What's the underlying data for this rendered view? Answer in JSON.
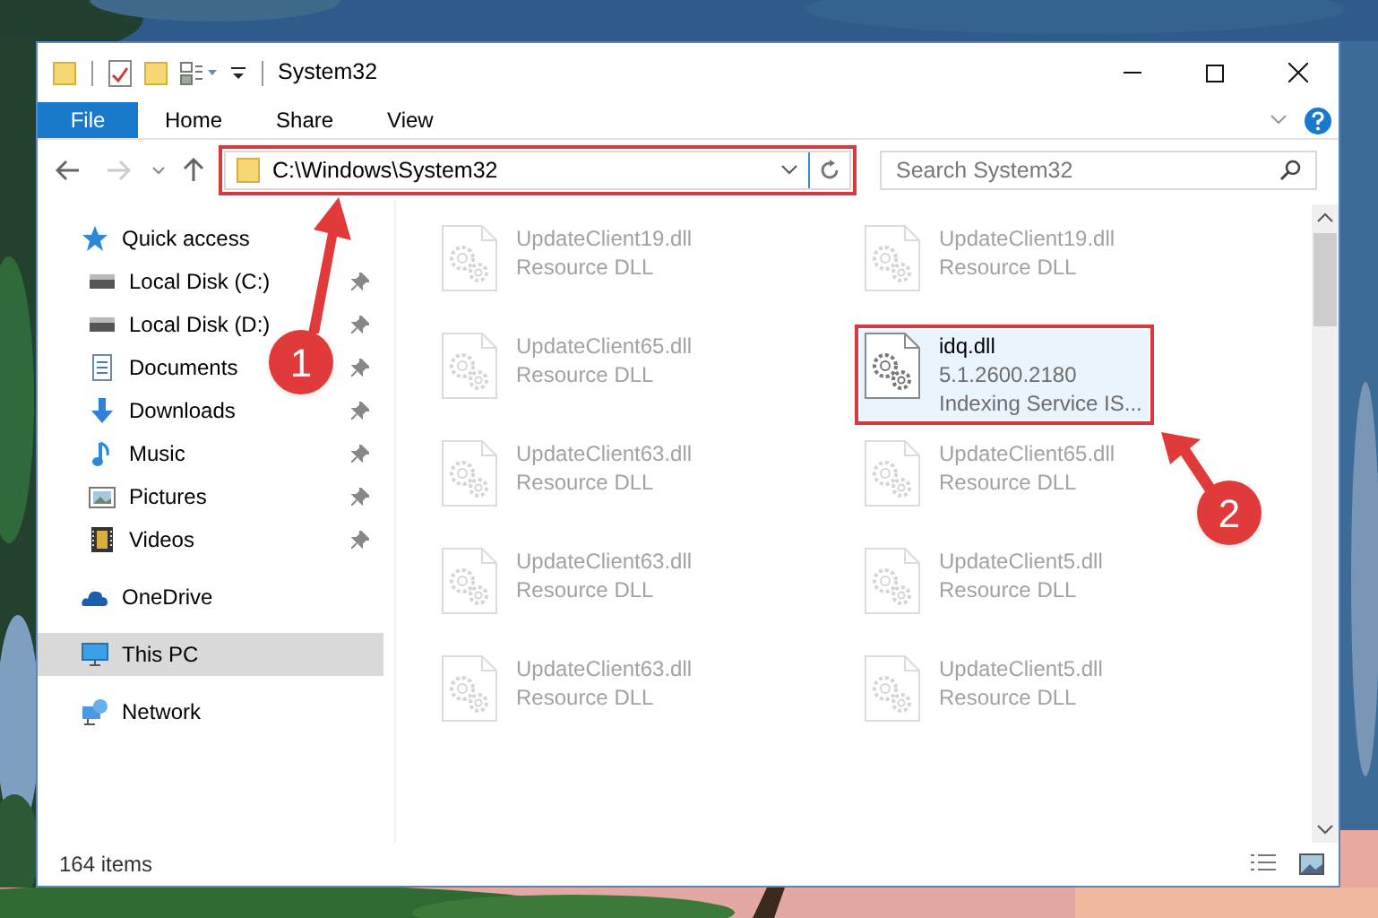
{
  "window": {
    "title": "System32"
  },
  "ribbon": {
    "tabs": [
      {
        "label": "File",
        "kind": "file",
        "selected": false
      },
      {
        "label": "Home",
        "kind": "tab",
        "selected": false
      },
      {
        "label": "Share",
        "kind": "tab",
        "selected": false
      },
      {
        "label": "View",
        "kind": "tab",
        "selected": false
      }
    ]
  },
  "address": {
    "path": "C:\\Windows\\System32",
    "highlighted": true
  },
  "search": {
    "placeholder": "Search System32"
  },
  "nav": {
    "items": [
      {
        "label": "Quick access",
        "kind": "star",
        "selected": false,
        "children": [
          {
            "label": "Local Disk (C:)",
            "kind": "drive",
            "pinned": true,
            "selected": false
          },
          {
            "label": "Local Disk (D:)",
            "kind": "drive",
            "pinned": true,
            "selected": false
          },
          {
            "label": "Documents",
            "kind": "documents",
            "pinned": true,
            "selected": false
          },
          {
            "label": "Downloads",
            "kind": "downloads",
            "pinned": true,
            "selected": false
          },
          {
            "label": "Music",
            "kind": "music",
            "pinned": true,
            "selected": false
          },
          {
            "label": "Pictures",
            "kind": "pictures",
            "pinned": true,
            "selected": false
          },
          {
            "label": "Videos",
            "kind": "videos",
            "pinned": true,
            "selected": false
          }
        ]
      },
      {
        "label": "OneDrive",
        "kind": "cloud",
        "selected": false
      },
      {
        "label": "This PC",
        "kind": "pc",
        "selected": true
      },
      {
        "label": "Network",
        "kind": "network",
        "selected": false
      }
    ]
  },
  "files": [
    {
      "name": "UpdateClient19.dll",
      "detail": "Resource DLL",
      "dimmed": true,
      "selected": false,
      "highlighted": false
    },
    {
      "name": "UpdateClient19.dll",
      "detail": "Resource DLL",
      "dimmed": true,
      "selected": false,
      "highlighted": false
    },
    {
      "name": "UpdateClient65.dll",
      "detail": "Resource DLL",
      "dimmed": true,
      "selected": false,
      "highlighted": false
    },
    {
      "name": "idq.dll",
      "version": "5.1.2600.2180",
      "detail": "Indexing Service IS...",
      "dimmed": false,
      "selected": true,
      "highlighted": true
    },
    {
      "name": "UpdateClient63.dll",
      "detail": "Resource DLL",
      "dimmed": true,
      "selected": false,
      "highlighted": false
    },
    {
      "name": "UpdateClient65.dll",
      "detail": "Resource DLL",
      "dimmed": true,
      "selected": false,
      "highlighted": false
    },
    {
      "name": "UpdateClient63.dll",
      "detail": "Resource DLL",
      "dimmed": true,
      "selected": false,
      "highlighted": false
    },
    {
      "name": "UpdateClient5.dll",
      "detail": "Resource DLL",
      "dimmed": true,
      "selected": false,
      "highlighted": false
    },
    {
      "name": "UpdateClient63.dll",
      "detail": "Resource DLL",
      "dimmed": true,
      "selected": false,
      "highlighted": false
    },
    {
      "name": "UpdateClient5.dll",
      "detail": "Resource DLL",
      "dimmed": true,
      "selected": false,
      "highlighted": false
    }
  ],
  "status_bar": {
    "count": "164 items"
  },
  "annotations": [
    {
      "label": "1"
    },
    {
      "label": "2"
    }
  ]
}
